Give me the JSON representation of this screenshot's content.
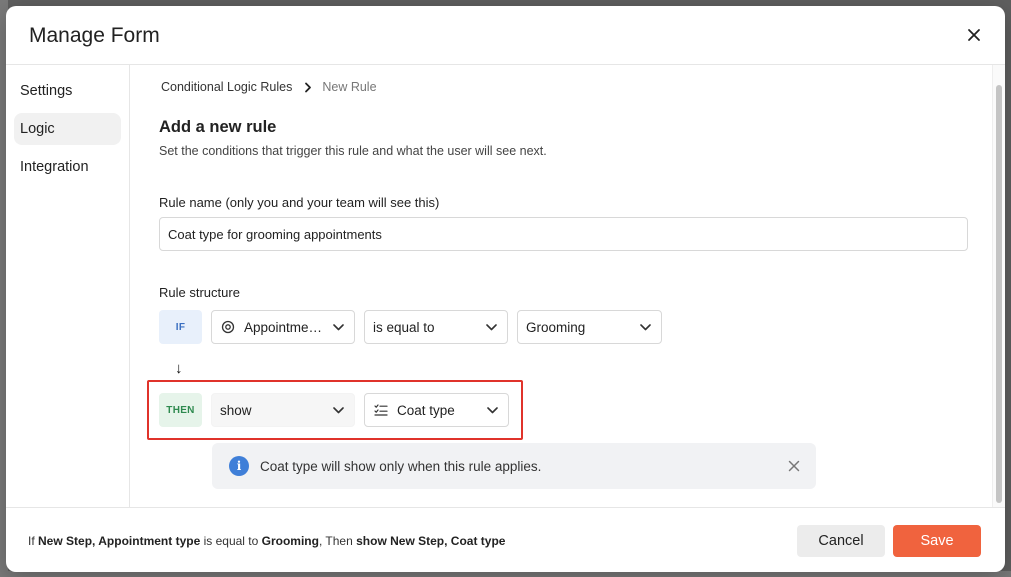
{
  "modal": {
    "title": "Manage Form"
  },
  "sidebar": {
    "items": [
      {
        "label": "Settings",
        "active": false
      },
      {
        "label": "Logic",
        "active": true
      },
      {
        "label": "Integration",
        "active": false
      }
    ]
  },
  "breadcrumb": {
    "parent": "Conditional Logic Rules",
    "current": "New Rule"
  },
  "section": {
    "title": "Add a new rule",
    "subtitle": "Set the conditions that trigger this rule and what the user will see next."
  },
  "rule_name": {
    "label": "Rule name (only you and your team will see this)",
    "value": "Coat type for grooming appointments"
  },
  "rule_structure": {
    "label": "Rule structure",
    "if_label": "IF",
    "then_label": "THEN",
    "condition": {
      "field": "Appointment...",
      "operator": "is equal to",
      "value": "Grooming"
    },
    "action": {
      "type": "show",
      "target": "Coat type"
    },
    "arrow": "↓"
  },
  "info_banner": {
    "text": "Coat type will show only when this rule applies."
  },
  "footer": {
    "summary": {
      "if": "If",
      "cond_field": "New Step, Appointment type",
      "op": "is equal to",
      "cond_value": "Grooming",
      "then": ", Then",
      "action": "show New Step, Coat type"
    },
    "cancel_label": "Cancel",
    "save_label": "Save"
  },
  "colors": {
    "accent": "#f0633e",
    "highlight": "#e0332b",
    "info": "#3f7fd8",
    "if_pill_bg": "#e8f0fb",
    "then_pill_bg": "#e6f4ea"
  },
  "icons": {
    "close": "close-icon",
    "breadcrumb_separator": "chevron-right-icon",
    "condition_field": "target-icon",
    "action_target": "list-icon",
    "dropdown": "chevron-down-icon",
    "info": "info-icon",
    "banner_close": "close-icon"
  }
}
